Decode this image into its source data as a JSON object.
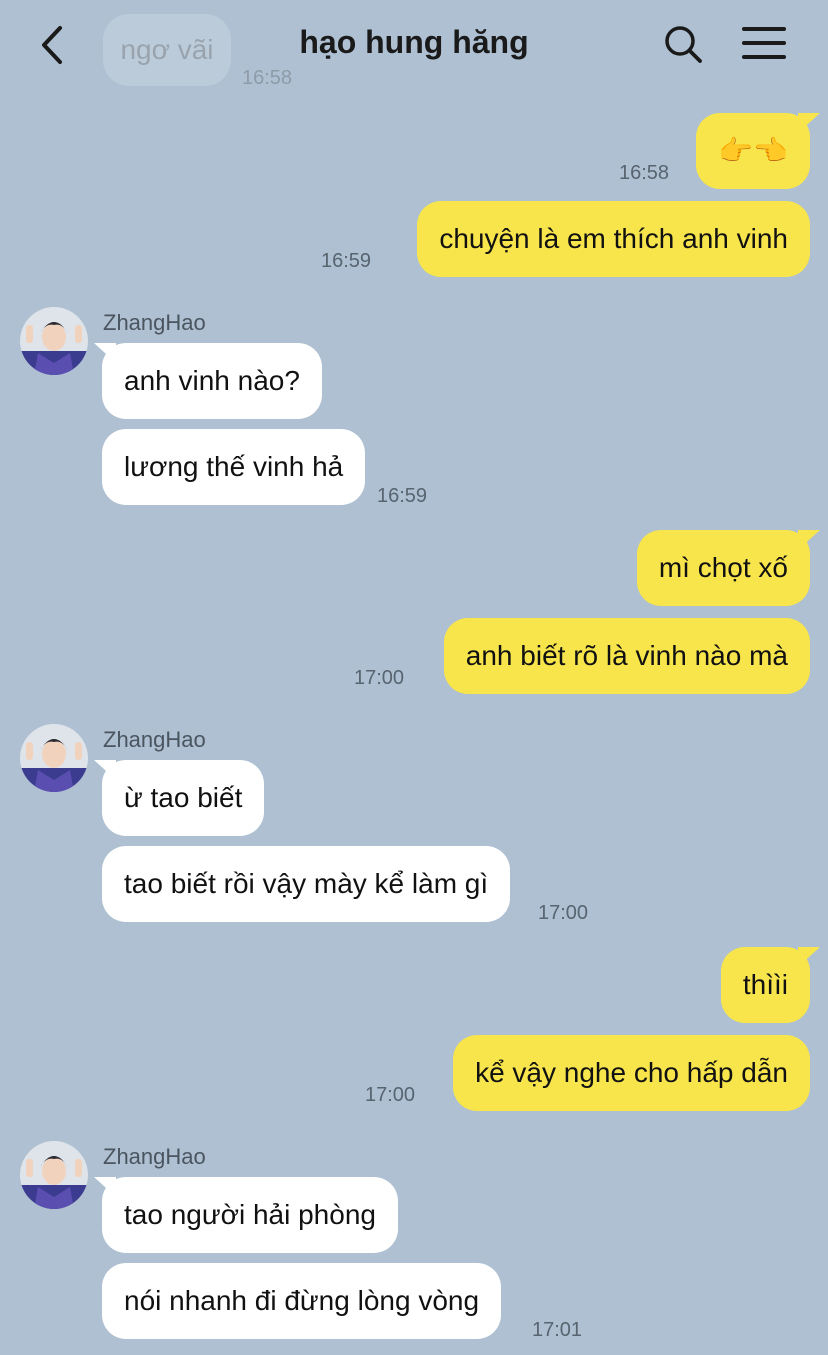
{
  "header": {
    "title": "hạo hung hăng",
    "prev_bubble_text": "ngơ vãi",
    "prev_bubble_time": "16:58",
    "back_icon": "back-chevron-icon",
    "search_icon": "search-icon",
    "menu_icon": "menu-icon"
  },
  "colors": {
    "background": "#aec0d1",
    "outgoing_bubble": "#f8e54c",
    "incoming_bubble": "#ffffff"
  },
  "messages": [
    {
      "direction": "out",
      "text": "👉👈",
      "time": "16:58"
    },
    {
      "direction": "out",
      "text": "chuyện là em thích anh vinh",
      "time": "16:59"
    },
    {
      "direction": "in",
      "sender": "ZhangHao",
      "text": "anh vinh nào?"
    },
    {
      "direction": "in",
      "text": "lương thế vinh hả",
      "time": "16:59"
    },
    {
      "direction": "out",
      "text": "mì chọt xố"
    },
    {
      "direction": "out",
      "text": "anh biết rõ là vinh nào mà",
      "time": "17:00"
    },
    {
      "direction": "in",
      "sender": "ZhangHao",
      "text": "ừ tao biết"
    },
    {
      "direction": "in",
      "text": "tao biết rồi vậy mày kể làm gì",
      "time": "17:00"
    },
    {
      "direction": "out",
      "text": "thììi"
    },
    {
      "direction": "out",
      "text": "kể vậy nghe cho hấp dẫn",
      "time": "17:00"
    },
    {
      "direction": "in",
      "sender": "ZhangHao",
      "text": "tao người hải phòng"
    },
    {
      "direction": "in",
      "text": "nói nhanh đi đừng lòng vòng",
      "time": "17:01"
    }
  ]
}
